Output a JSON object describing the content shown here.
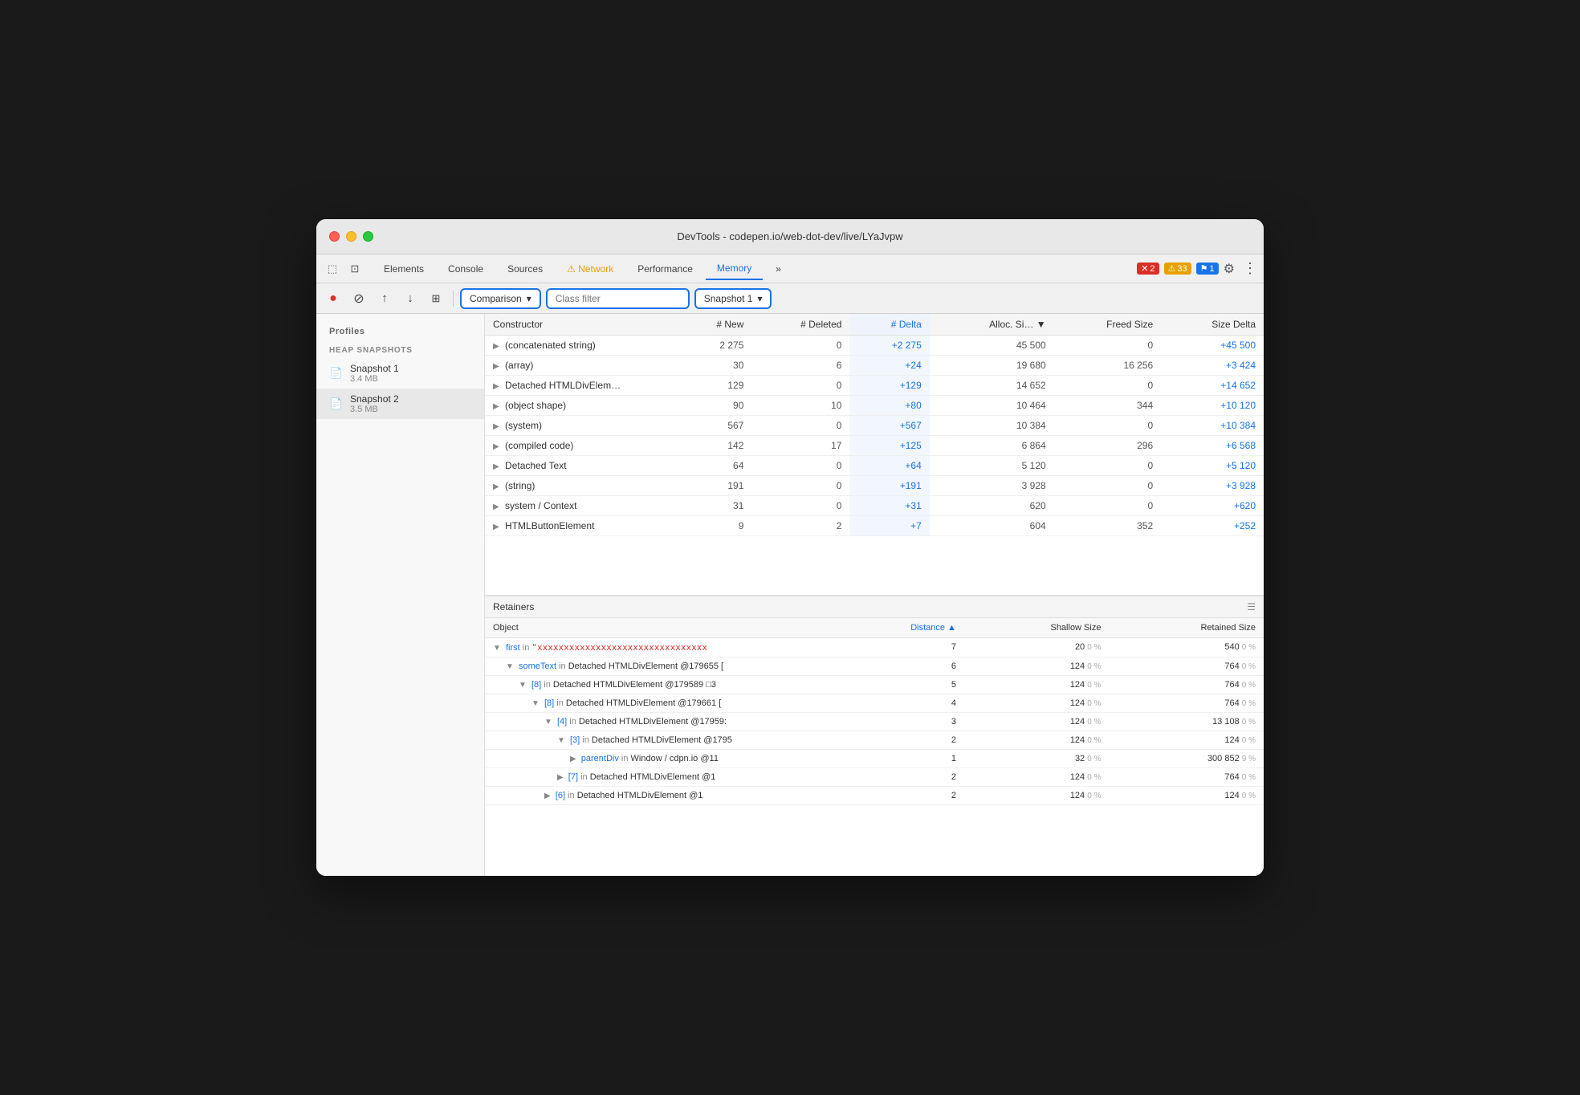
{
  "window": {
    "title": "DevTools - codepen.io/web-dot-dev/live/LYaJvpw"
  },
  "tabs": {
    "items": [
      {
        "label": "Elements",
        "active": false
      },
      {
        "label": "Console",
        "active": false
      },
      {
        "label": "Sources",
        "active": false
      },
      {
        "label": "Network",
        "active": false,
        "warning": true
      },
      {
        "label": "Performance",
        "active": false
      },
      {
        "label": "Memory",
        "active": true
      },
      {
        "label": "»",
        "active": false
      }
    ],
    "badges": [
      {
        "type": "error",
        "icon": "✕",
        "count": "2"
      },
      {
        "type": "warning",
        "icon": "⚠",
        "count": "33"
      },
      {
        "type": "blue",
        "icon": "⚑",
        "count": "1"
      }
    ]
  },
  "toolbar": {
    "record_label": "●",
    "clear_label": "⊘",
    "upload_label": "↑",
    "download_label": "↓",
    "heap_label": "⊞",
    "comparison_label": "Comparison",
    "class_filter_placeholder": "Class filter",
    "snapshot_label": "Snapshot 1"
  },
  "sidebar": {
    "profiles_heading": "Profiles",
    "heap_heading": "HEAP SNAPSHOTS",
    "snapshots": [
      {
        "name": "Snapshot 1",
        "size": "3.4 MB",
        "active": false
      },
      {
        "name": "Snapshot 2",
        "size": "3.5 MB",
        "active": true
      }
    ]
  },
  "table": {
    "headers": [
      {
        "label": "Constructor",
        "col": "constructor"
      },
      {
        "label": "# New",
        "col": "new"
      },
      {
        "label": "# Deleted",
        "col": "deleted"
      },
      {
        "label": "# Delta",
        "col": "delta",
        "sorted": true
      },
      {
        "label": "Alloc. Si… ▼",
        "col": "alloc"
      },
      {
        "label": "Freed Size",
        "col": "freed"
      },
      {
        "label": "Size Delta",
        "col": "sizedelta"
      }
    ],
    "rows": [
      {
        "constructor": "(concatenated string)",
        "new": "2 275",
        "deleted": "0",
        "delta": "+2 275",
        "alloc": "45 500",
        "freed": "0",
        "sizedelta": "+45 500"
      },
      {
        "constructor": "(array)",
        "new": "30",
        "deleted": "6",
        "delta": "+24",
        "alloc": "19 680",
        "freed": "16 256",
        "sizedelta": "+3 424"
      },
      {
        "constructor": "Detached HTMLDivElem…",
        "new": "129",
        "deleted": "0",
        "delta": "+129",
        "alloc": "14 652",
        "freed": "0",
        "sizedelta": "+14 652"
      },
      {
        "constructor": "(object shape)",
        "new": "90",
        "deleted": "10",
        "delta": "+80",
        "alloc": "10 464",
        "freed": "344",
        "sizedelta": "+10 120"
      },
      {
        "constructor": "(system)",
        "new": "567",
        "deleted": "0",
        "delta": "+567",
        "alloc": "10 384",
        "freed": "0",
        "sizedelta": "+10 384"
      },
      {
        "constructor": "(compiled code)",
        "new": "142",
        "deleted": "17",
        "delta": "+125",
        "alloc": "6 864",
        "freed": "296",
        "sizedelta": "+6 568"
      },
      {
        "constructor": "Detached Text",
        "new": "64",
        "deleted": "0",
        "delta": "+64",
        "alloc": "5 120",
        "freed": "0",
        "sizedelta": "+5 120"
      },
      {
        "constructor": "(string)",
        "new": "191",
        "deleted": "0",
        "delta": "+191",
        "alloc": "3 928",
        "freed": "0",
        "sizedelta": "+3 928"
      },
      {
        "constructor": "system / Context",
        "new": "31",
        "deleted": "0",
        "delta": "+31",
        "alloc": "620",
        "freed": "0",
        "sizedelta": "+620"
      },
      {
        "constructor": "HTMLButtonElement",
        "new": "9",
        "deleted": "2",
        "delta": "+7",
        "alloc": "604",
        "freed": "352",
        "sizedelta": "+252"
      }
    ]
  },
  "retainers": {
    "heading": "Retainers",
    "headers": [
      {
        "label": "Object"
      },
      {
        "label": "Distance ▲",
        "sorted": true
      },
      {
        "label": "Shallow Size"
      },
      {
        "label": "Retained Size"
      }
    ],
    "rows": [
      {
        "indent": 0,
        "expand": "▼",
        "key": "first",
        "sep": " in ",
        "ref": "\"xxxxxxxxxxxxxxxxxxxxxxxxxxxxxxxx",
        "distance": "7",
        "shallow": "20",
        "shallow_pct": "0 %",
        "retained": "540",
        "retained_pct": "0 %"
      },
      {
        "indent": 1,
        "expand": "▼",
        "key": "someText",
        "sep": " in ",
        "ref": "Detached HTMLDivElement @179655 [",
        "distance": "6",
        "shallow": "124",
        "shallow_pct": "0 %",
        "retained": "764",
        "retained_pct": "0 %"
      },
      {
        "indent": 2,
        "expand": "▼",
        "key": "[8]",
        "sep": " in ",
        "ref": "Detached HTMLDivElement @179589 □3",
        "distance": "5",
        "shallow": "124",
        "shallow_pct": "0 %",
        "retained": "764",
        "retained_pct": "0 %"
      },
      {
        "indent": 3,
        "expand": "▼",
        "key": "[8]",
        "sep": " in ",
        "ref": "Detached HTMLDivElement @179661 [",
        "distance": "4",
        "shallow": "124",
        "shallow_pct": "0 %",
        "retained": "764",
        "retained_pct": "0 %"
      },
      {
        "indent": 4,
        "expand": "▼",
        "key": "[4]",
        "sep": " in ",
        "ref": "Detached HTMLDivElement @17959:",
        "distance": "3",
        "shallow": "124",
        "shallow_pct": "0 %",
        "retained": "13 108",
        "retained_pct": "0 %"
      },
      {
        "indent": 5,
        "expand": "▼",
        "key": "[3]",
        "sep": " in ",
        "ref": "Detached HTMLDivElement @1795",
        "distance": "2",
        "shallow": "124",
        "shallow_pct": "0 %",
        "retained": "124",
        "retained_pct": "0 %"
      },
      {
        "indent": 6,
        "expand": "▶",
        "key": "parentDiv",
        "sep": " in ",
        "ref": "Window / cdpn.io @11",
        "distance": "1",
        "shallow": "32",
        "shallow_pct": "0 %",
        "retained": "300 852",
        "retained_pct": "9 %"
      },
      {
        "indent": 5,
        "expand": "▶",
        "key": "[7]",
        "sep": " in ",
        "ref": "Detached HTMLDivElement @1",
        "distance": "2",
        "shallow": "124",
        "shallow_pct": "0 %",
        "retained": "764",
        "retained_pct": "0 %"
      },
      {
        "indent": 4,
        "expand": "▶",
        "key": "[6]",
        "sep": " in ",
        "ref": "Detached HTMLDivElement @1",
        "distance": "2",
        "shallow": "124",
        "shallow_pct": "0 %",
        "retained": "124",
        "retained_pct": "0 %"
      }
    ]
  }
}
